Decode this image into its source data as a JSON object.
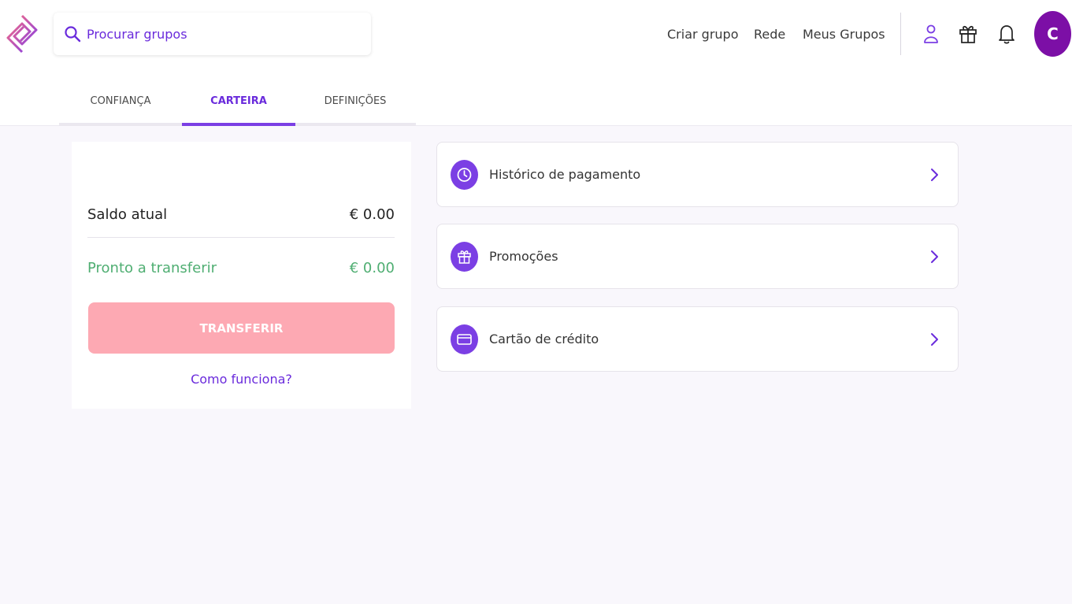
{
  "header": {
    "search": {
      "placeholder": "Procurar grupos"
    },
    "nav": [
      "Criar grupo",
      "Rede",
      "Meus Grupos"
    ],
    "icons": [
      "user-icon",
      "gift-icon",
      "bell-icon"
    ],
    "avatar_initial": "C"
  },
  "tabs": [
    {
      "label": "CONFIANÇA",
      "active": false
    },
    {
      "label": "CARTEIRA",
      "active": true
    },
    {
      "label": "DEFINIÇÕES",
      "active": false
    }
  ],
  "wallet": {
    "balance_label": "Saldo atual",
    "balance_value": "€ 0.00",
    "ready_label": "Pronto a transferir",
    "ready_value": "€ 0.00",
    "transfer_button": "TRANSFERIR",
    "how_link": "Como funciona?"
  },
  "options": [
    {
      "label": "Histórico de pagamento",
      "icon": "clock-icon"
    },
    {
      "label": "Promoções",
      "icon": "gift-icon"
    },
    {
      "label": "Cartão de crédito",
      "icon": "credit-card-icon"
    }
  ],
  "colors": {
    "accent": "#7b3fe4",
    "link": "#6a2bdc",
    "ready_green": "#4fae72",
    "transfer_button": "#fda9b3",
    "avatar": "#7c0fa6"
  }
}
